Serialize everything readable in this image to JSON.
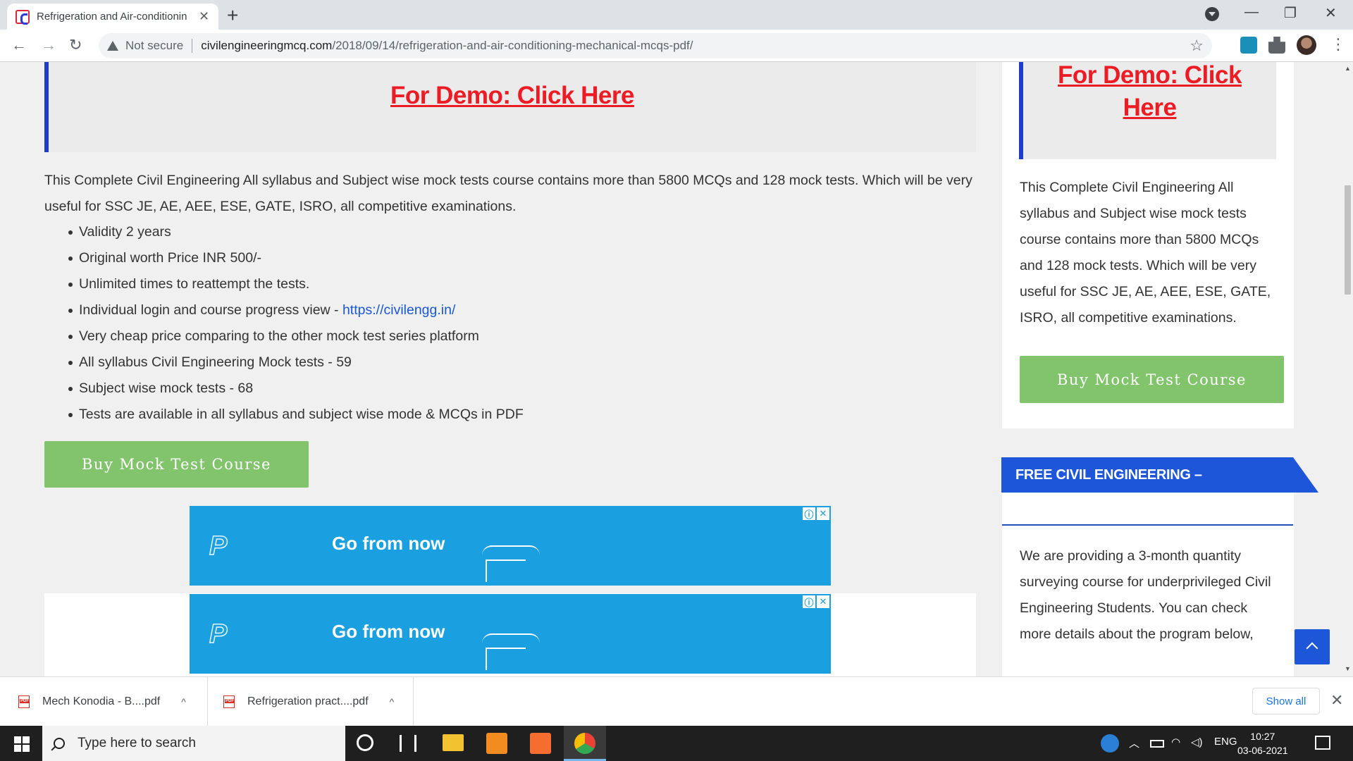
{
  "browser": {
    "tab_title": "Refrigeration and Air-conditionin",
    "tab_close": "✕",
    "new_tab": "+",
    "minimize": "—",
    "maximize": "❐",
    "close": "✕",
    "back": "←",
    "forward": "→",
    "reload": "↻",
    "security_label": "Not secure",
    "url_host": "civilengineeringmcq.com",
    "url_path": "/2018/09/14/refrigeration-and-air-conditioning-mechanical-mcqs-pdf/",
    "star": "☆",
    "menu": "⋮"
  },
  "main": {
    "demo_link": "For Demo: Click Here",
    "description": "This Complete Civil Engineering All syllabus and Subject wise mock tests course contains more than 5800 MCQs and 128 mock tests. Which will be very useful for SSC JE, AE, AEE, ESE, GATE, ISRO, all competitive examinations.",
    "bullets": [
      "Validity 2 years",
      "Original worth Price INR 500/-",
      "Unlimited times to reattempt the tests.",
      "Individual login and course progress view - ",
      "Very cheap price comparing to the other mock test series platform",
      "All syllabus Civil Engineering Mock tests - 59",
      "Subject wise mock tests - 68",
      "Tests are available in all syllabus and subject wise mode & MCQs in PDF"
    ],
    "course_link": "https://civilengg.in/",
    "buy_button": "Buy Mock Test Course"
  },
  "ads": [
    {
      "text": "Go from now",
      "logo": "P",
      "info": "ⓘ",
      "close": "✕"
    },
    {
      "text": "Go from now",
      "logo": "P",
      "info": "ⓘ",
      "close": "✕"
    }
  ],
  "sidebar": {
    "demo_link_line1": "For Demo: Click",
    "demo_link_line2": "Here",
    "description": "This Complete Civil Engineering All syllabus and Subject wise mock tests course contains more than 5800 MCQs and 128 mock tests. Which will be very useful for SSC JE, AE, AEE, ESE, GATE, ISRO, all competitive examinations.",
    "buy_button": "Buy Mock Test Course",
    "free_heading": "FREE CIVIL ENGINEERING –",
    "free_text": "We are providing a 3-month quantity surveying course for underprivileged Civil Engineering Students.  You can check more details about the program below,"
  },
  "downloads": {
    "items": [
      "Mech Konodia - B....pdf",
      "Refrigeration pract....pdf"
    ],
    "caret": "^",
    "show_all": "Show all",
    "close": "✕"
  },
  "taskbar": {
    "search_placeholder": "Type here to search",
    "language": "ENG",
    "time": "10:27",
    "date": "03-06-2021"
  }
}
